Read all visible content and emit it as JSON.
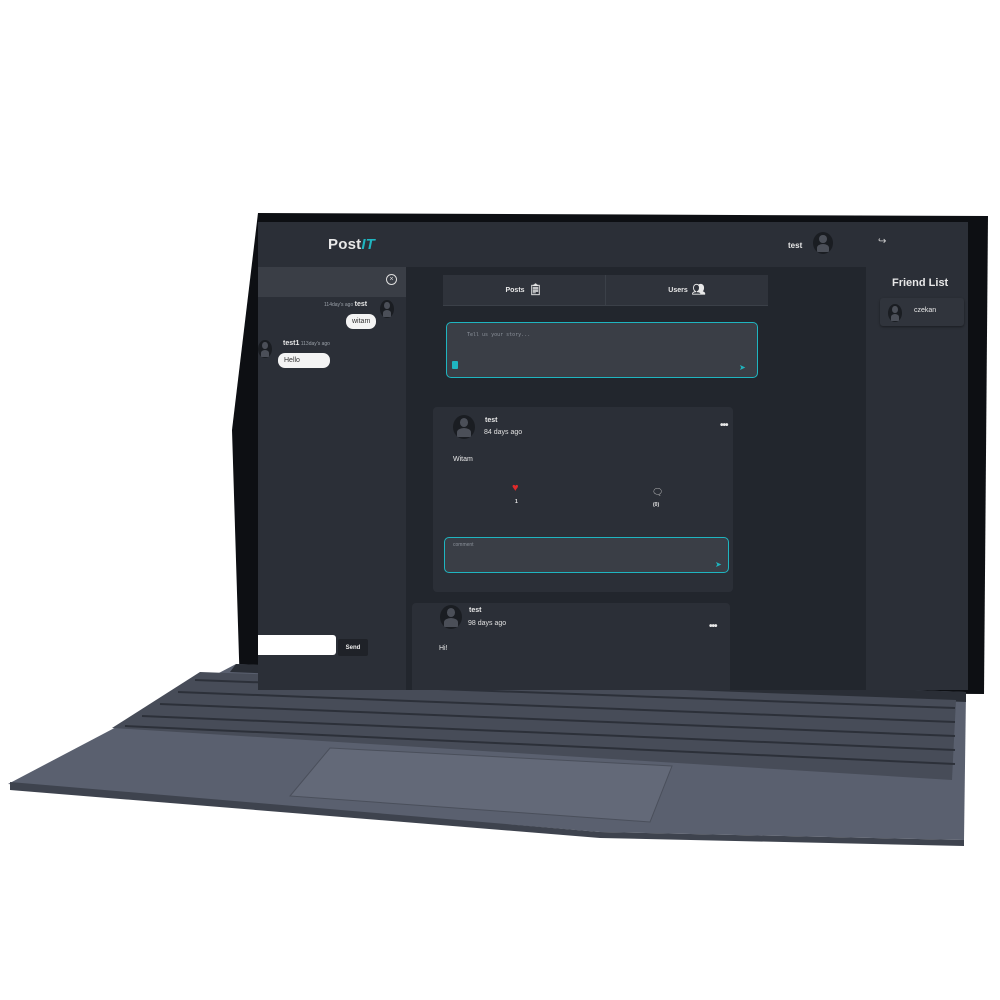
{
  "app": {
    "logo_main": "Post",
    "logo_accent": "IT"
  },
  "header": {
    "username": "test"
  },
  "chat": {
    "messages": [
      {
        "author": "test",
        "time": "114day's ago",
        "text": "witam"
      },
      {
        "author": "test1",
        "time": "113day's ago",
        "text": "Hello"
      }
    ],
    "send_label": "Send"
  },
  "tabs": [
    {
      "label": "Posts",
      "icon": "clipboard-icon"
    },
    {
      "label": "Users",
      "icon": "users-icon"
    }
  ],
  "composer": {
    "placeholder": "Tell us your story..."
  },
  "posts": [
    {
      "author": "test",
      "date": "84 days ago",
      "text": "Witam",
      "likes": "1",
      "comments": "(0)",
      "comment_placeholder": "comment"
    },
    {
      "author": "test",
      "date": "98 days ago",
      "text": "Hi!"
    }
  ],
  "friends": {
    "title": "Friend List",
    "items": [
      "czekan"
    ]
  },
  "colors": {
    "accent": "#1fb5c0",
    "like": "#e12a2a",
    "background": "#2b2f37"
  }
}
